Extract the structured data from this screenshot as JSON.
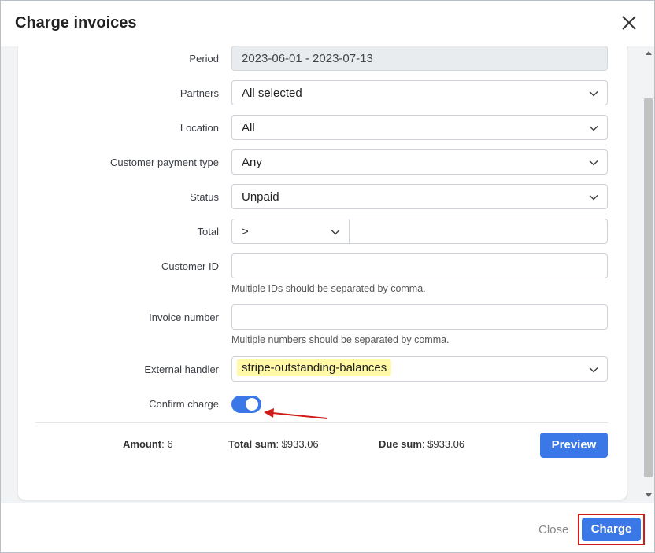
{
  "modal": {
    "title": "Charge invoices"
  },
  "form": {
    "period": {
      "label": "Period",
      "value": "2023-06-01 - 2023-07-13"
    },
    "partners": {
      "label": "Partners",
      "value": "All selected"
    },
    "location": {
      "label": "Location",
      "value": "All"
    },
    "customer_payment_type": {
      "label": "Customer payment type",
      "value": "Any"
    },
    "status": {
      "label": "Status",
      "value": "Unpaid"
    },
    "total": {
      "label": "Total",
      "operator": ">",
      "value": ""
    },
    "customer_id": {
      "label": "Customer ID",
      "value": "",
      "hint": "Multiple IDs should be separated by comma."
    },
    "invoice_number": {
      "label": "Invoice number",
      "value": "",
      "hint": "Multiple numbers should be separated by comma."
    },
    "external_handler": {
      "label": "External handler",
      "value": "stripe-outstanding-balances"
    },
    "confirm_charge": {
      "label": "Confirm charge",
      "enabled": true
    }
  },
  "summary": {
    "amount_label": "Amount",
    "amount_value": "6",
    "total_sum_label": "Total sum",
    "total_sum_value": "$933.06",
    "due_sum_label": "Due sum",
    "due_sum_value": "$933.06"
  },
  "buttons": {
    "preview": "Preview",
    "close": "Close",
    "charge": "Charge"
  },
  "colors": {
    "primary": "#3b78e7",
    "highlight": "#fff9a8",
    "annotation_red": "#d11a1a"
  }
}
